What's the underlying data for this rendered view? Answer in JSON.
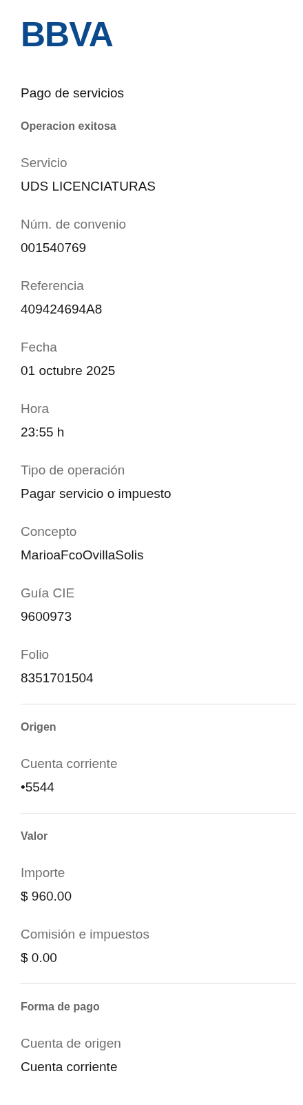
{
  "logo": "BBVA",
  "title": "Pago de servicios",
  "sections": [
    {
      "heading": "Operacion exitosa",
      "fields": [
        {
          "label": "Servicio",
          "value": "UDS LICENCIATURAS"
        },
        {
          "label": "Núm. de convenio",
          "value": "001540769"
        },
        {
          "label": "Referencia",
          "value": "409424694A8"
        },
        {
          "label": "Fecha",
          "value": "01 octubre 2025"
        },
        {
          "label": "Hora",
          "value": "23:55 h"
        },
        {
          "label": "Tipo de operación",
          "value": "Pagar servicio o impuesto"
        },
        {
          "label": "Concepto",
          "value": "MarioaFcoOvillaSolis"
        },
        {
          "label": "Guía CIE",
          "value": "9600973"
        },
        {
          "label": "Folio",
          "value": "8351701504"
        }
      ]
    },
    {
      "heading": "Origen",
      "fields": [
        {
          "label": "Cuenta corriente",
          "value": "•5544"
        }
      ]
    },
    {
      "heading": "Valor",
      "fields": [
        {
          "label": "Importe",
          "value": "$ 960.00"
        },
        {
          "label": "Comisión e impuestos",
          "value": "$ 0.00"
        }
      ]
    },
    {
      "heading": "Forma de pago",
      "fields": [
        {
          "label": "Cuenta de origen",
          "value": "Cuenta corriente"
        }
      ]
    }
  ]
}
